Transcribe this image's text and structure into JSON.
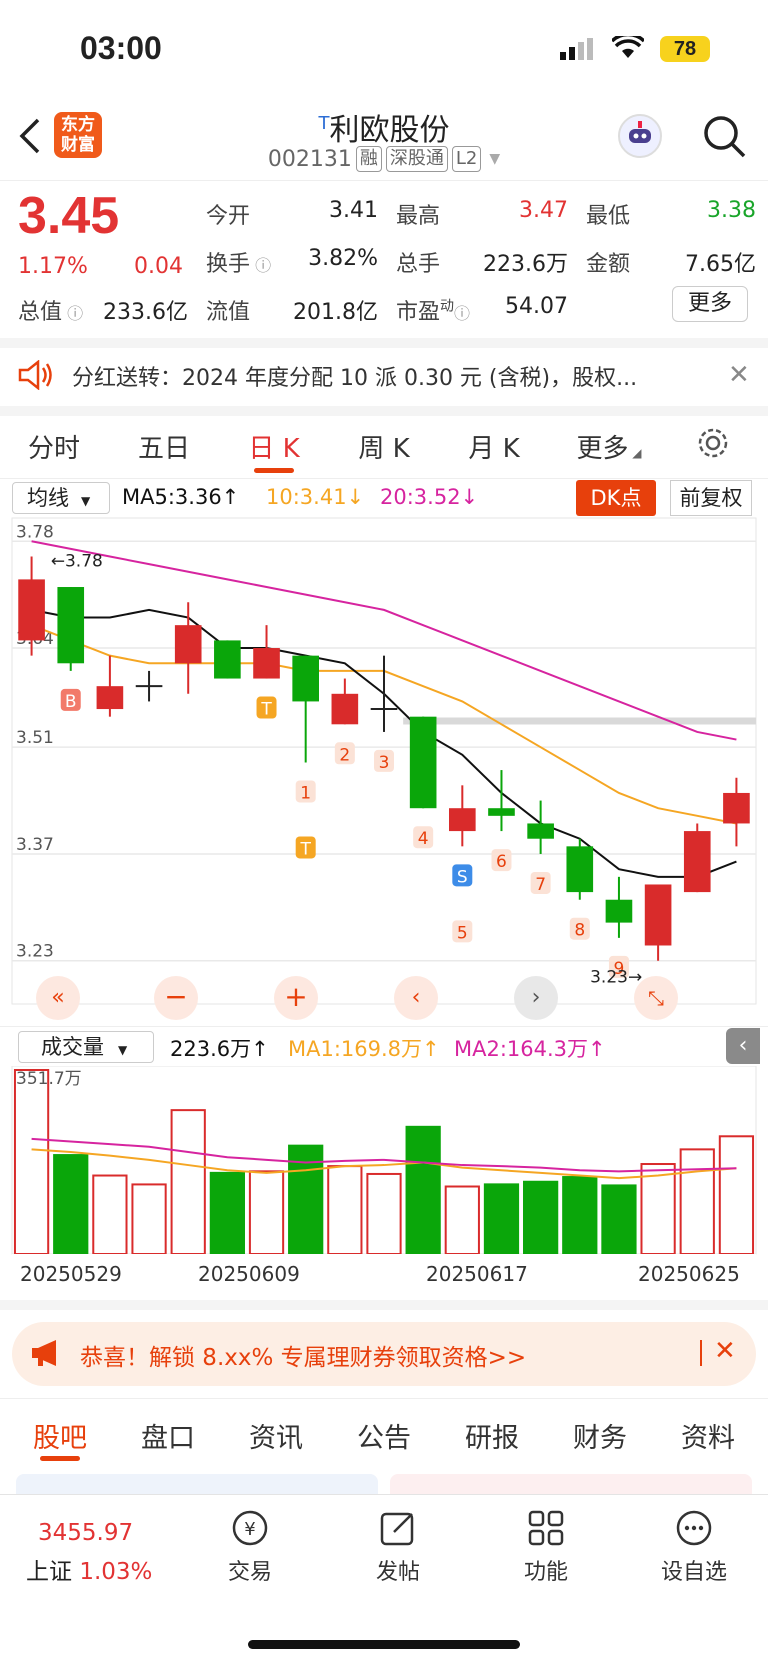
{
  "status": {
    "time": "03:00",
    "battery": "78"
  },
  "header": {
    "stock_name": "利欧股份",
    "name_prefix": "T",
    "code": "002131",
    "tags": [
      "融",
      "深股通",
      "L2"
    ],
    "logo_line1": "东方",
    "logo_line2": "财富"
  },
  "quote": {
    "price": "3.45",
    "change_pct": "1.17%",
    "change": "0.04",
    "open_label": "今开",
    "open": "3.41",
    "high_label": "最高",
    "high": "3.47",
    "low_label": "最低",
    "low": "3.38",
    "turnover_label": "换手",
    "turnover": "3.82%",
    "volume_label": "总手",
    "volume": "223.6万",
    "amount_label": "金额",
    "amount": "7.65亿",
    "mcap_label": "总值",
    "mcap": "233.6亿",
    "float_label": "流值",
    "float": "201.8亿",
    "pe_label": "市盈",
    "pe_sup": "动",
    "pe": "54.07",
    "more": "更多"
  },
  "notice": {
    "text": "分红送转：2024 年度分配 10 派 0.30 元 (含税)，股权..."
  },
  "chart_tabs": [
    "分时",
    "五日",
    "日 K",
    "周 K",
    "月 K",
    "更多"
  ],
  "chart_toolbar": {
    "indicator": "均线",
    "ma5": "MA5:3.36↑",
    "ma10": "10:3.41↓",
    "ma20": "20:3.52↓",
    "dk": "DK点",
    "adjust": "前复权"
  },
  "colors": {
    "up": "#d92b2b",
    "down": "#0aa60a",
    "ma5": "#111111",
    "ma10": "#f5a623",
    "ma20": "#d6249f",
    "accent": "#e7400c"
  },
  "chart_data": {
    "type": "candlestick",
    "y_ticks": [
      "3.78",
      "3.64",
      "3.51",
      "3.37",
      "3.23"
    ],
    "max_label": "3.78",
    "min_label": "3.23",
    "candles": [
      {
        "o": 3.65,
        "c": 3.73,
        "h": 3.76,
        "l": 3.63
      },
      {
        "o": 3.72,
        "c": 3.62,
        "h": 3.72,
        "l": 3.61
      },
      {
        "o": 3.56,
        "c": 3.59,
        "h": 3.63,
        "l": 3.55
      },
      {
        "o": 3.59,
        "c": 3.59,
        "h": 3.61,
        "l": 3.57
      },
      {
        "o": 3.62,
        "c": 3.67,
        "h": 3.7,
        "l": 3.58
      },
      {
        "o": 3.65,
        "c": 3.6,
        "h": 3.65,
        "l": 3.6
      },
      {
        "o": 3.6,
        "c": 3.64,
        "h": 3.67,
        "l": 3.6
      },
      {
        "o": 3.63,
        "c": 3.57,
        "h": 3.63,
        "l": 3.49
      },
      {
        "o": 3.54,
        "c": 3.58,
        "h": 3.6,
        "l": 3.54
      },
      {
        "o": 3.56,
        "c": 3.56,
        "h": 3.63,
        "l": 3.53
      },
      {
        "o": 3.55,
        "c": 3.43,
        "h": 3.55,
        "l": 3.43
      },
      {
        "o": 3.4,
        "c": 3.43,
        "h": 3.46,
        "l": 3.38
      },
      {
        "o": 3.43,
        "c": 3.42,
        "h": 3.48,
        "l": 3.4
      },
      {
        "o": 3.41,
        "c": 3.39,
        "h": 3.44,
        "l": 3.37
      },
      {
        "o": 3.38,
        "c": 3.32,
        "h": 3.39,
        "l": 3.31
      },
      {
        "o": 3.31,
        "c": 3.28,
        "h": 3.34,
        "l": 3.26
      },
      {
        "o": 3.25,
        "c": 3.33,
        "h": 3.33,
        "l": 3.23
      },
      {
        "o": 3.32,
        "c": 3.4,
        "h": 3.41,
        "l": 3.32
      },
      {
        "o": 3.41,
        "c": 3.45,
        "h": 3.47,
        "l": 3.38
      }
    ],
    "ma5": [
      3.69,
      3.68,
      3.68,
      3.69,
      3.68,
      3.64,
      3.64,
      3.63,
      3.62,
      3.58,
      3.53,
      3.5,
      3.45,
      3.41,
      3.39,
      3.35,
      3.34,
      3.34,
      3.36
    ],
    "ma10": [
      3.67,
      3.65,
      3.63,
      3.62,
      3.62,
      3.62,
      3.62,
      3.61,
      3.61,
      3.61,
      3.59,
      3.57,
      3.54,
      3.51,
      3.48,
      3.45,
      3.43,
      3.42,
      3.41
    ],
    "ma20": [
      3.78,
      3.77,
      3.76,
      3.75,
      3.74,
      3.73,
      3.72,
      3.71,
      3.7,
      3.69,
      3.67,
      3.65,
      3.63,
      3.61,
      3.59,
      3.57,
      3.55,
      3.53,
      3.52
    ],
    "markers": [
      {
        "i": 1,
        "text": "B"
      },
      {
        "i": 6,
        "text": "T"
      },
      {
        "i": 7,
        "text": "1"
      },
      {
        "i": 7,
        "text": "T"
      },
      {
        "i": 8,
        "text": "2"
      },
      {
        "i": 9,
        "text": "3"
      },
      {
        "i": 10,
        "text": "4"
      },
      {
        "i": 11,
        "text": "S"
      },
      {
        "i": 11,
        "text": "5"
      },
      {
        "i": 12,
        "text": "6"
      },
      {
        "i": 13,
        "text": "7"
      },
      {
        "i": 14,
        "text": "8"
      },
      {
        "i": 15,
        "text": "9"
      }
    ],
    "volume": {
      "max_label": "351.7万",
      "values": [
        351.7,
        191,
        150,
        133,
        275,
        157,
        158,
        209,
        168,
        153,
        245,
        129,
        135,
        140,
        149,
        133,
        172,
        200,
        225
      ],
      "ma1": [
        200,
        195,
        188,
        180,
        170,
        160,
        155,
        160,
        168,
        170,
        175,
        165,
        160,
        155,
        150,
        145,
        150,
        158,
        164
      ],
      "ma2": [
        220,
        215,
        210,
        205,
        195,
        185,
        180,
        175,
        178,
        180,
        175,
        170,
        168,
        165,
        160,
        158,
        160,
        162,
        164
      ]
    },
    "x_labels": [
      "20250529",
      "20250609",
      "20250617",
      "20250625"
    ]
  },
  "volume_toolbar": {
    "indicator": "成交量",
    "value": "223.6万↑",
    "ma1": "MA1:169.8万↑",
    "ma2": "MA2:164.3万↑"
  },
  "promo": {
    "text": "恭喜！解锁 8.xx% 专属理财券领取资格>>"
  },
  "bottom_tabs": [
    "股吧",
    "盘口",
    "资讯",
    "公告",
    "研报",
    "财务",
    "资料"
  ],
  "bottom_bar": {
    "index_value": "3455.97",
    "index_name": "上证",
    "index_pct": "1.03%",
    "items": [
      "交易",
      "发帖",
      "功能",
      "设自选"
    ]
  }
}
